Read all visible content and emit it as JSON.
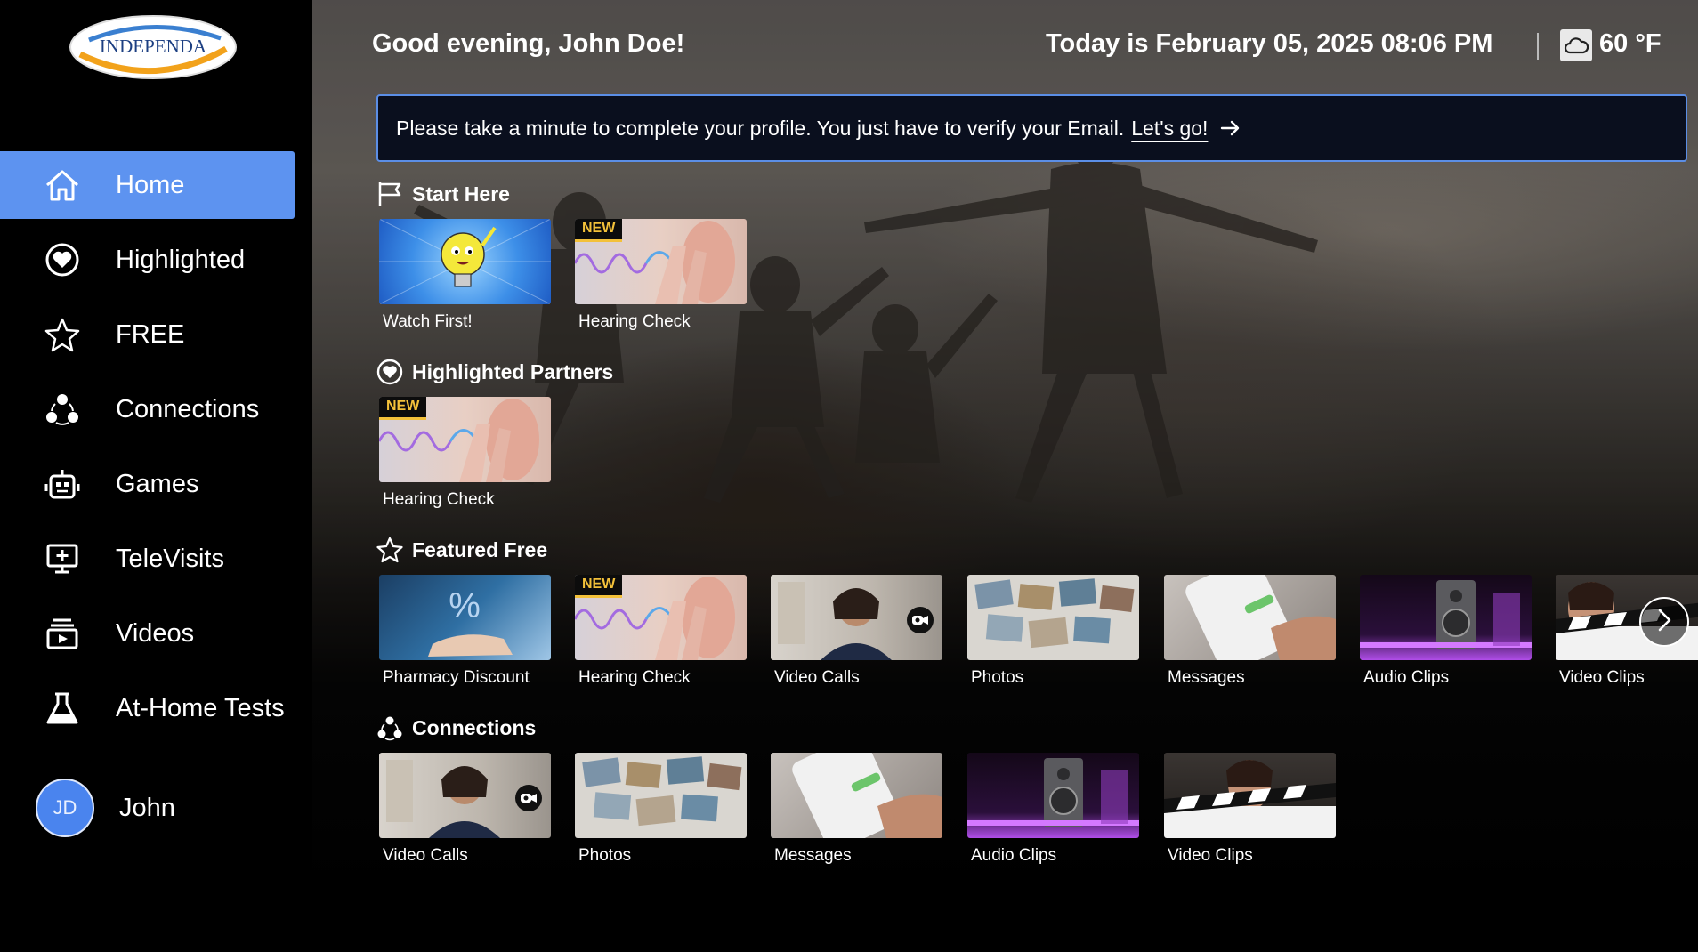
{
  "app": {
    "logo_text": "INDEPENDA"
  },
  "sidebar": {
    "items": [
      {
        "label": "Home",
        "icon": "home-icon",
        "active": true
      },
      {
        "label": "Highlighted",
        "icon": "heart-badge-icon"
      },
      {
        "label": "FREE",
        "icon": "star-icon"
      },
      {
        "label": "Connections",
        "icon": "connections-icon"
      },
      {
        "label": "Games",
        "icon": "robot-icon"
      },
      {
        "label": "TeleVisits",
        "icon": "monitor-plus-icon"
      },
      {
        "label": "Videos",
        "icon": "video-library-icon"
      },
      {
        "label": "At-Home Tests",
        "icon": "flask-icon"
      }
    ],
    "user": {
      "initials": "JD",
      "name": "John"
    },
    "accent": "#5d93f0"
  },
  "header": {
    "greeting": "Good evening, John Doe!",
    "datetime": "Today is February 05, 2025 08:06 PM",
    "temperature": "60 °F",
    "weather_icon": "cloud-icon"
  },
  "banner": {
    "text": "Please take a minute to complete your profile. You just have to  verify your Email.",
    "link": "Let's go!",
    "border_color": "#5b8ee6"
  },
  "sections": {
    "start_here": {
      "title": "Start Here",
      "tiles": [
        {
          "label": "Watch First!",
          "badge": ""
        },
        {
          "label": "Hearing Check",
          "badge": "NEW"
        }
      ]
    },
    "highlighted_partners": {
      "title": "Highlighted Partners",
      "tiles": [
        {
          "label": "Hearing Check",
          "badge": "NEW"
        }
      ]
    },
    "featured_free": {
      "title": "Featured Free",
      "tiles": [
        {
          "label": "Pharmacy Discount",
          "badge": ""
        },
        {
          "label": "Hearing Check",
          "badge": "NEW"
        },
        {
          "label": "Video Calls",
          "badge": ""
        },
        {
          "label": "Photos",
          "badge": ""
        },
        {
          "label": "Messages",
          "badge": ""
        },
        {
          "label": "Audio Clips",
          "badge": ""
        },
        {
          "label": "Video Clips",
          "badge": ""
        }
      ]
    },
    "connections": {
      "title": "Connections",
      "tiles": [
        {
          "label": "Video Calls"
        },
        {
          "label": "Photos"
        },
        {
          "label": "Messages"
        },
        {
          "label": "Audio Clips"
        },
        {
          "label": "Video Clips"
        }
      ]
    }
  },
  "badge_color": "#f3c13a"
}
